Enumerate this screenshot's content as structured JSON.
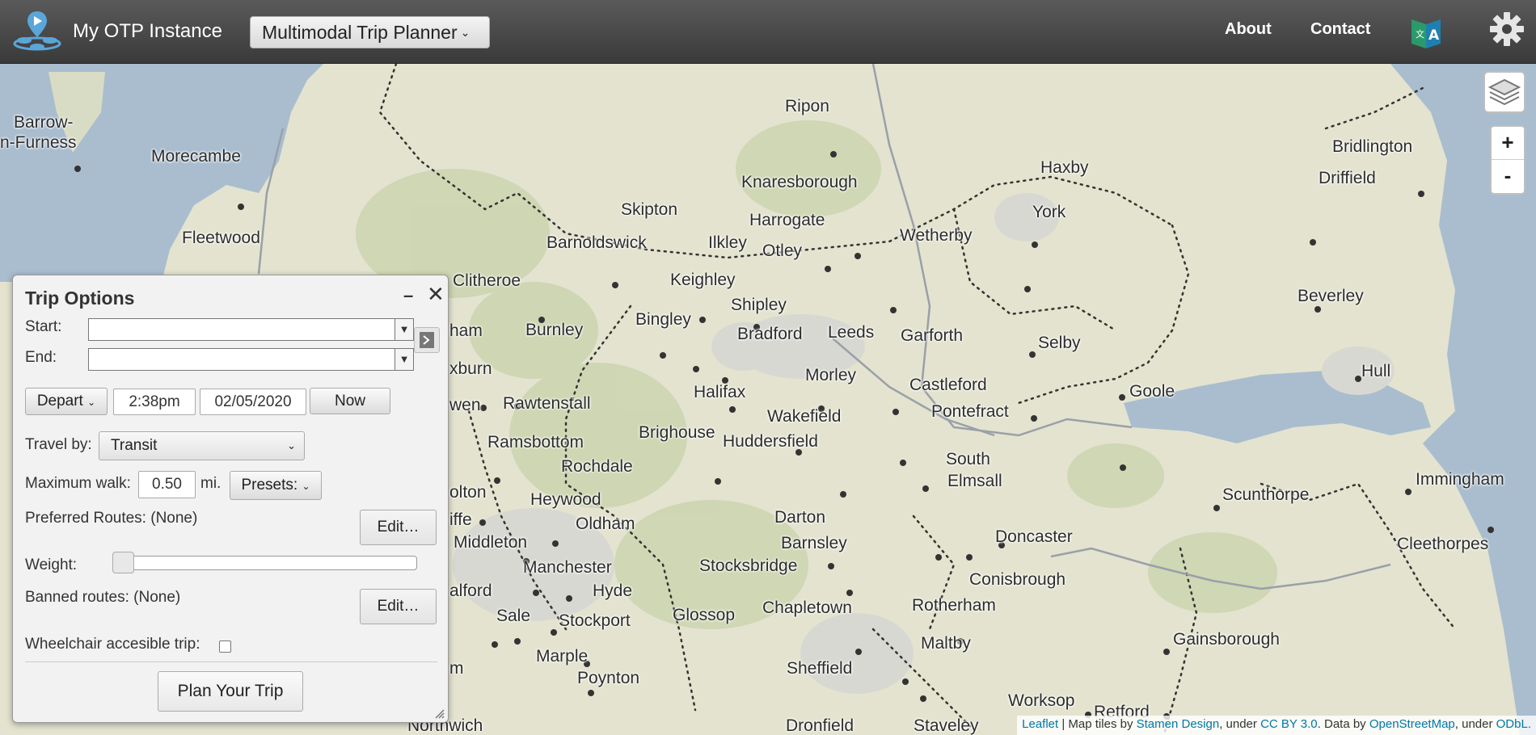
{
  "navbar": {
    "brand": "My OTP Instance",
    "mode_selector": "Multimodal Trip Planner",
    "links": [
      "About",
      "Contact"
    ],
    "icons": [
      "otp-logo-icon",
      "translate-icon",
      "gear-icon"
    ]
  },
  "map": {
    "cities": [
      "Barrow-",
      "n-Furness",
      "Morecambe",
      "Fleetwood",
      "Ripon",
      "Knaresborough",
      "Harrogate",
      "Skipton",
      "Barnoldswick",
      "Ilkley",
      "Otley",
      "Keighley",
      "Shipley",
      "Bingley",
      "Bradford",
      "Leeds",
      "Wetherby",
      "Haxby",
      "York",
      "Garforth",
      "Selby",
      "Morley",
      "Castleford",
      "Pontefract",
      "Goole",
      "Halifax",
      "Wakefield",
      "Brighouse",
      "Huddersfield",
      "South",
      "Elmsall",
      "Clitheroe",
      "Burnley",
      "ham",
      "xburn",
      "wen",
      "Rawtenstall",
      "Ramsbottom",
      "Rochdale",
      "olton",
      "iffe",
      "Heywood",
      "Middleton",
      "Oldham",
      "Manchester",
      "alford",
      "Hyde",
      "Sale",
      "Stockport",
      "Glossop",
      "Marple",
      "Poynton",
      "m",
      "Darton",
      "Barnsley",
      "Stocksbridge",
      "Chapletown",
      "Doncaster",
      "Conisbrough",
      "Rotherham",
      "Maltby",
      "Sheffield",
      "Worksop",
      "Retford",
      "Dronfield",
      "Staveley",
      "Northwich",
      "Bridlington",
      "Driffield",
      "Beverley",
      "Hull",
      "Immingham",
      "Scunthorpe",
      "Cleethorpes",
      "Gainsborough"
    ],
    "zoom_in": "+",
    "zoom_out": "-",
    "attribution": {
      "leaflet": "Leaflet",
      "t1": " | Map tiles by ",
      "stamen": "Stamen Design",
      "t2": ", under ",
      "ccby": "CC BY 3.0",
      "t3": ". Data by ",
      "osm": "OpenStreetMap",
      "t4": ", under ",
      "odbl": "ODbL."
    }
  },
  "trip_options": {
    "title": "Trip Options",
    "minimize": "–",
    "close": "✕",
    "start_label": "Start:",
    "start_value": "",
    "end_label": "End:",
    "end_value": "",
    "depart_label": "Depart",
    "time_value": "2:38pm",
    "date_value": "02/05/2020",
    "now_label": "Now",
    "travel_by_label": "Travel by:",
    "travel_by_value": "Transit",
    "max_walk_label": "Maximum walk:",
    "max_walk_value": "0.50",
    "max_walk_unit": "mi.",
    "presets_label": "Presets:",
    "preferred_routes_label": "Preferred Routes: (None)",
    "edit_label": "Edit…",
    "weight_label": "Weight:",
    "banned_routes_label": "Banned routes: (None)",
    "wheelchair_label": "Wheelchair accesible trip:",
    "wheelchair_checked": false,
    "plan_button": "Plan Your Trip"
  }
}
